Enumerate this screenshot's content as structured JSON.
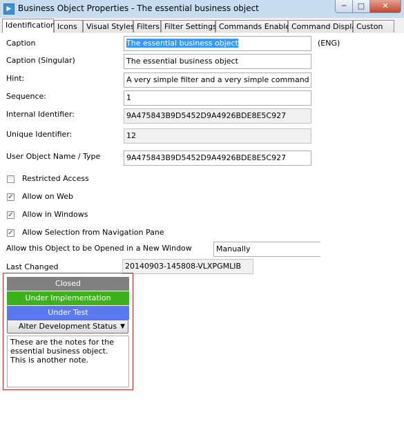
{
  "window": {
    "title": "Business Object Properties - The essential business object",
    "icon_name": "app-icon",
    "controls": {
      "minimize": "─",
      "maximize": "□",
      "close": "✕"
    }
  },
  "tabs": [
    {
      "label": "Identification",
      "active": true
    },
    {
      "label": "Icons"
    },
    {
      "label": "Visual Styles"
    },
    {
      "label": "Filters"
    },
    {
      "label": "Filter Settings"
    },
    {
      "label": "Commands Enabled"
    },
    {
      "label": "Command Display"
    },
    {
      "label": "Custon"
    }
  ],
  "form": {
    "caption": {
      "label": "Caption",
      "value": "The essential business object",
      "lang": "(ENG)"
    },
    "caption_singular": {
      "label": "Caption (Singular)",
      "value": "The essential business object"
    },
    "hint": {
      "label": "Hint:",
      "value": "A very simple filter and a very simple command handler"
    },
    "sequence": {
      "label": "Sequence:",
      "value": "1"
    },
    "internal_id": {
      "label": "Internal Identifier:",
      "value": "9A475843B9D5452D9A4926BDE8E5C927"
    },
    "unique_id": {
      "label": "Unique Identifier:",
      "value": "12"
    },
    "user_object": {
      "label": "User Object Name / Type",
      "value": "9A475843B9D5452D9A4926BDE8E5C927"
    },
    "restricted_access": {
      "label": "Restricted Access",
      "checked": false
    },
    "allow_web": {
      "label": "Allow on Web",
      "checked": true
    },
    "allow_windows": {
      "label": "Allow in Windows",
      "checked": true
    },
    "allow_nav": {
      "label": "Allow Selection from Navigation Pane",
      "checked": true
    },
    "open_new_window": {
      "label": "Allow this Object to be Opened in a New Window",
      "value": "Manually"
    },
    "last_changed": {
      "label": "Last Changed",
      "value": "20140903-145808-VLXPGMLIB"
    }
  },
  "check_glyph": "✓",
  "status": {
    "bars": [
      {
        "label": "Closed",
        "color": "#808080"
      },
      {
        "label": "Under Implementation",
        "color": "#3cb11c"
      },
      {
        "label": "Under Test",
        "color": "#5a78f0"
      }
    ],
    "alter_button": "Alter Development Status",
    "dropdown_arrow": "▼",
    "notes": "These are the notes for the\nessential business object.\nThis is another note.",
    "border_color": "#d42222"
  }
}
